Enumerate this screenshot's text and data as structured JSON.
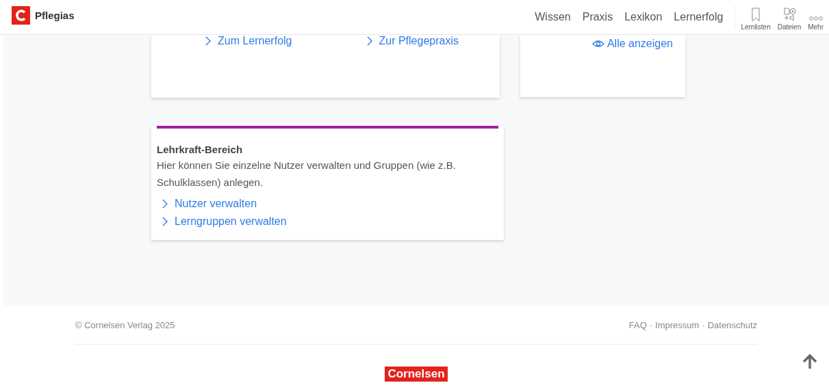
{
  "header": {
    "brand": "Pflegias",
    "nav": [
      {
        "label": "Wissen"
      },
      {
        "label": "Praxis"
      },
      {
        "label": "Lexikon"
      },
      {
        "label": "Lernerfolg"
      }
    ],
    "tools": [
      {
        "kind": "bookmark",
        "label": "Lernlisten"
      },
      {
        "kind": "files",
        "label": "Dateien"
      },
      {
        "kind": "more",
        "label": "Mehr"
      }
    ]
  },
  "top_cards": [
    {
      "links": [
        "Zum Lernerfolg",
        "Zur Pflegepraxis"
      ]
    },
    {
      "link": "Alle anzeigen"
    }
  ],
  "teacher_card": {
    "title": "Lehrkraft-Bereich",
    "text": "Hier können Sie einzelne Nutzer verwalten und Gruppen (wie z.B. Schulklassen) anlegen.",
    "links": [
      "Nutzer verwalten",
      "Lerngruppen verwalten"
    ]
  },
  "footer": {
    "copyright": "© Cornelsen Verlag 2025",
    "links": [
      "FAQ",
      "Impressum",
      "Datenschutz"
    ],
    "separator": "·",
    "logo": "Cornelsen"
  }
}
